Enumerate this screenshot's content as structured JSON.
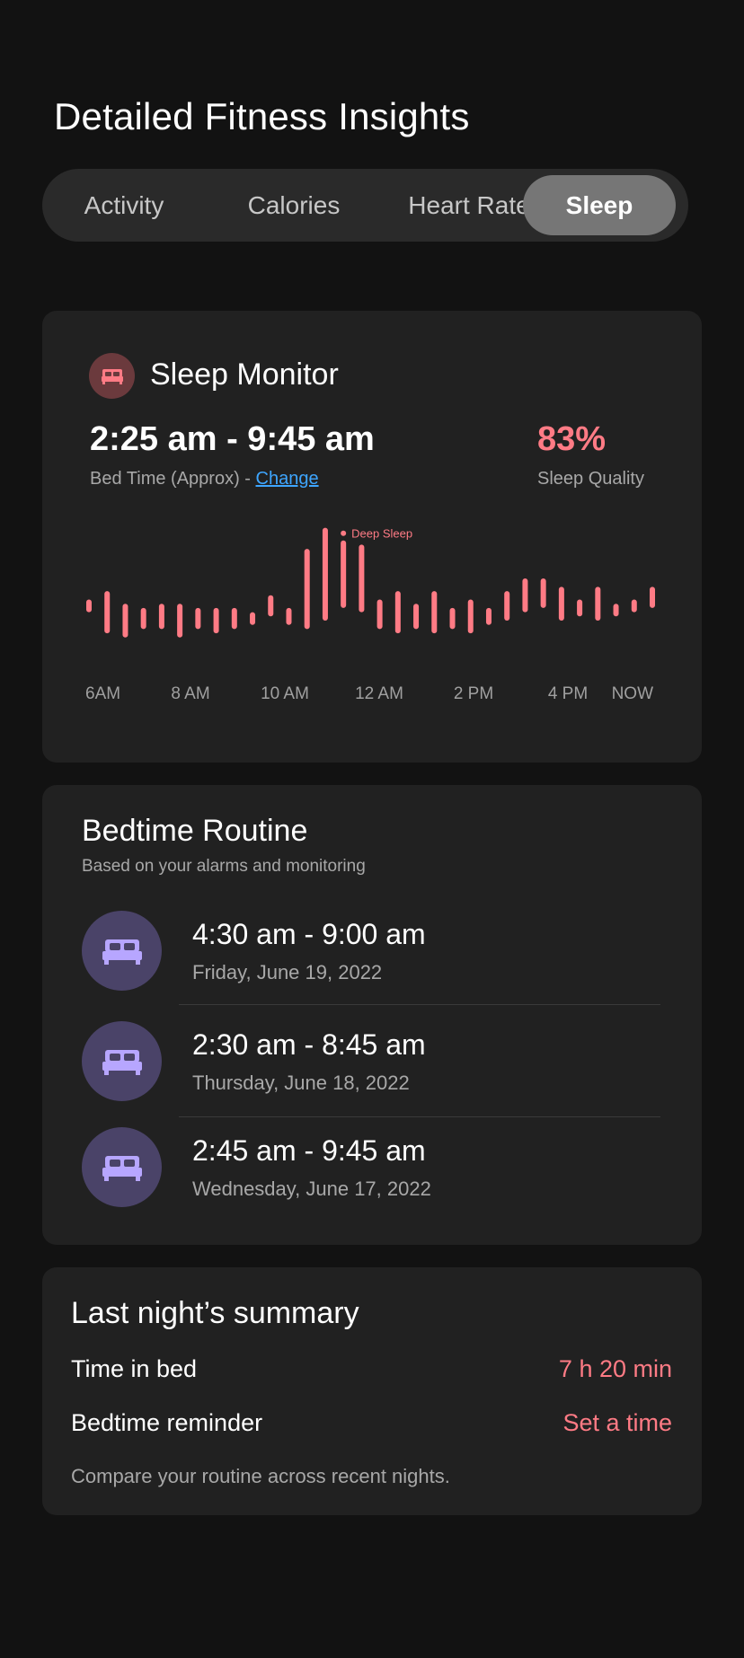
{
  "page_title": "Detailed Fitness Insights",
  "tabs": [
    {
      "label": "Activity"
    },
    {
      "label": "Calories"
    },
    {
      "label": "Heart Rate"
    },
    {
      "label": "Sleep"
    }
  ],
  "active_tab": "Sleep",
  "colors": {
    "accent": "#ff7b85",
    "link": "#3ea6ff",
    "routine_icon": "#b7a6ff",
    "routine_bg": "#4a4368"
  },
  "sleep_monitor": {
    "icon": "bed-icon",
    "title": "Sleep Monitor",
    "time_range": "2:25 am - 9:45 am",
    "bed_time_label": "Bed Time (Approx) - ",
    "change_link": "Change",
    "quality_value": "83%",
    "quality_label": "Sleep Quality"
  },
  "chart_data": {
    "type": "bar",
    "categories": [
      "6AM",
      "8 AM",
      "10 AM",
      "12 AM",
      "2 PM",
      "4 PM",
      "NOW"
    ],
    "annotation": "Deep Sleep",
    "annotation_bar_index": 14,
    "bars": [
      {
        "lo": 2,
        "hi": 5
      },
      {
        "lo": -3,
        "hi": 7
      },
      {
        "lo": -4,
        "hi": 4
      },
      {
        "lo": -2,
        "hi": 3
      },
      {
        "lo": -2,
        "hi": 4
      },
      {
        "lo": -4,
        "hi": 4
      },
      {
        "lo": -2,
        "hi": 3
      },
      {
        "lo": -3,
        "hi": 3
      },
      {
        "lo": -2,
        "hi": 3
      },
      {
        "lo": -1,
        "hi": 2
      },
      {
        "lo": 1,
        "hi": 6
      },
      {
        "lo": -1,
        "hi": 3
      },
      {
        "lo": -2,
        "hi": 17
      },
      {
        "lo": 0,
        "hi": 22
      },
      {
        "lo": 3,
        "hi": 19
      },
      {
        "lo": 2,
        "hi": 18
      },
      {
        "lo": -2,
        "hi": 5
      },
      {
        "lo": -3,
        "hi": 7
      },
      {
        "lo": -2,
        "hi": 4
      },
      {
        "lo": -3,
        "hi": 7
      },
      {
        "lo": -2,
        "hi": 3
      },
      {
        "lo": -3,
        "hi": 5
      },
      {
        "lo": -1,
        "hi": 3
      },
      {
        "lo": 0,
        "hi": 7
      },
      {
        "lo": 2,
        "hi": 10
      },
      {
        "lo": 3,
        "hi": 10
      },
      {
        "lo": 0,
        "hi": 8
      },
      {
        "lo": 1,
        "hi": 5
      },
      {
        "lo": 0,
        "hi": 8
      },
      {
        "lo": 1,
        "hi": 4
      },
      {
        "lo": 2,
        "hi": 5
      },
      {
        "lo": 3,
        "hi": 8
      }
    ]
  },
  "routine": {
    "title": "Bedtime Routine",
    "subtitle": "Based on your alarms and monitoring",
    "items": [
      {
        "time": "4:30 am - 9:00 am",
        "date": "Friday, June 19, 2022"
      },
      {
        "time": "2:30 am - 8:45 am",
        "date": "Thursday, June 18, 2022"
      },
      {
        "time": "2:45 am - 9:45 am",
        "date": "Wednesday, June 17, 2022"
      }
    ]
  },
  "summary": {
    "title": "Last night’s summary",
    "rows": [
      {
        "label": "Time in bed",
        "value": "7 h 20 min"
      },
      {
        "label": "Bedtime reminder",
        "value": "Set a time"
      }
    ],
    "note": "Compare your routine across recent nights."
  }
}
